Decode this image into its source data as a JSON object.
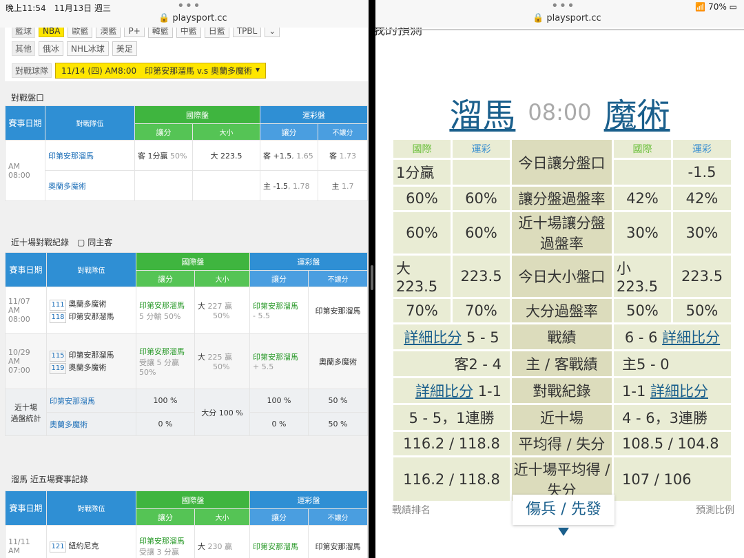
{
  "status": {
    "time": "晚上11:54",
    "date": "11月13日 週三",
    "battery": "70%"
  },
  "url": "playsport.cc",
  "left": {
    "tags_basketball": [
      "籃球",
      "NBA",
      "歐籃",
      "澳籃",
      "P+",
      "韓籃",
      "中籃",
      "日籃",
      "TPBL"
    ],
    "tags_other_label": "其他",
    "tags_other": [
      "俄冰",
      "NHL冰球",
      "美足"
    ],
    "match_label": "對戰球隊",
    "match_select": "11/14 (四) AM8:00　印第安那溜馬 v.s 奧蘭多魔術",
    "sect1": "對戰盤口",
    "sect2": "近十場對戰紀錄",
    "same_home": "同主客",
    "sect3": "溜馬 近五場賽事記錄",
    "hdr": {
      "date": "賽事日期",
      "teams": "對戰隊伍",
      "intl": "國際盤",
      "lottery": "運彩盤",
      "spread": "讓分",
      "ou": "大小",
      "spread2": "讓分",
      "noline": "不讓分"
    },
    "odds": {
      "ampm": "AM",
      "time": "08:00",
      "team1": "印第安那溜馬",
      "team2": "奧蘭多魔術",
      "r1": {
        "intl_spread": "客 1分贏",
        "intl_spread_pct": "50%",
        "ou": "大 223.5",
        "lot_spread": "客 +1.5",
        "lot_spread_odd": ", 1.65",
        "lot_ml": "客",
        "lot_ml_odd": "1.73"
      },
      "r2": {
        "lot_spread": "主 -1.5",
        "lot_spread_odd": ", 1.78",
        "lot_ml": "主",
        "lot_ml_odd": "1.7"
      }
    },
    "h2h": [
      {
        "date": "11/07",
        "ampm": "AM",
        "time": "08:00",
        "n1": "111",
        "t1": "奧蘭多魔術",
        "n2": "118",
        "t2": "印第安那溜馬",
        "spread_team": "印第安那溜馬",
        "spread_res": "5 分輸 50%",
        "ou": "大",
        "ou_val": "227",
        "ou_res": "贏",
        "ou_pct": "50%",
        "lot_team": "印第安那溜馬",
        "lot_line": "- 5.5",
        "ml": "印第安那溜馬"
      },
      {
        "date": "10/29",
        "ampm": "AM",
        "time": "07:00",
        "n1": "115",
        "t1": "印第安那溜馬",
        "n2": "119",
        "t2": "奧蘭多魔術",
        "spread_team": "印第安那溜馬",
        "spread_res": "受讓 5 分贏",
        "spread_pct": "50%",
        "ou": "大",
        "ou_val": "225",
        "ou_res": "贏",
        "ou_pct": "50%",
        "lot_team": "印第安那溜馬",
        "lot_line": "+ 5.5",
        "ml": "奧蘭多魔術"
      }
    ],
    "stats": {
      "label1": "近十場",
      "label2": "過盤統計",
      "t1": "印第安那溜馬",
      "t2": "奧蘭多魔術",
      "t1_spread": "100 %",
      "t2_spread": "0 %",
      "ou": "大分 100 %",
      "t1_lot": "100 %",
      "t2_lot": "0 %",
      "t1_ml": "50 %",
      "t2_ml": "50 %"
    },
    "recent": {
      "date": "11/11",
      "ampm": "AM",
      "n1": "121",
      "t1": "紐約尼克",
      "spread_team": "印第安那溜馬",
      "spread_res": "受讓 3 分贏",
      "ou": "大",
      "ou_val": "230",
      "ou_res": "贏",
      "lot_team": "印第安那溜馬",
      "ml": "印第安那溜馬"
    }
  },
  "right": {
    "top_partial": "我的預測",
    "home": "溜馬",
    "time": "08:00",
    "away": "魔術",
    "h_intl": "國際",
    "h_lot": "運彩",
    "rows": {
      "spread_label": "今日讓分盤口",
      "spread_l1": "1分贏",
      "spread_r2": "-1.5",
      "cover_label": "讓分盤過盤率",
      "cover_l1": "60%",
      "cover_l2": "60%",
      "cover_r1": "42%",
      "cover_r2": "42%",
      "last10_label": "近十場讓分盤過盤率",
      "last10_l1": "60%",
      "last10_l2": "60%",
      "last10_r1": "30%",
      "last10_r2": "30%",
      "ou_label": "今日大小盤口",
      "ou_l1": "大223.5",
      "ou_l2": "223.5",
      "ou_r1": "小223.5",
      "ou_r2": "223.5",
      "over_label": "大分過盤率",
      "over_l1": "70%",
      "over_l2": "70%",
      "over_r1": "50%",
      "over_r2": "50%",
      "record_label": "戰績",
      "record_l": "5 - 5",
      "record_r": "6 - 6",
      "detail": "詳細比分",
      "homeaway_label": "主 / 客戰績",
      "homeaway_l": "客2 - 4",
      "homeaway_r": "主5 - 0",
      "h2h_label": "對戰紀錄",
      "h2h_l": "1-1",
      "h2h_r": "1-1",
      "ten_label": "近十場",
      "ten_l": "5 - 5，1連勝",
      "ten_r": "4 - 6，3連勝",
      "avg_label": "平均得 / 失分",
      "avg_l": "116.2 / 118.8",
      "avg_r": "108.5 / 104.8",
      "avg10_label": "近十場平均得 / 失分",
      "avg10_l": "116.2 / 118.8",
      "avg10_r": "107 / 106"
    },
    "bottom_left": "戰績排名",
    "tab": "傷兵 / 先發",
    "bottom_right": "預測比例"
  }
}
